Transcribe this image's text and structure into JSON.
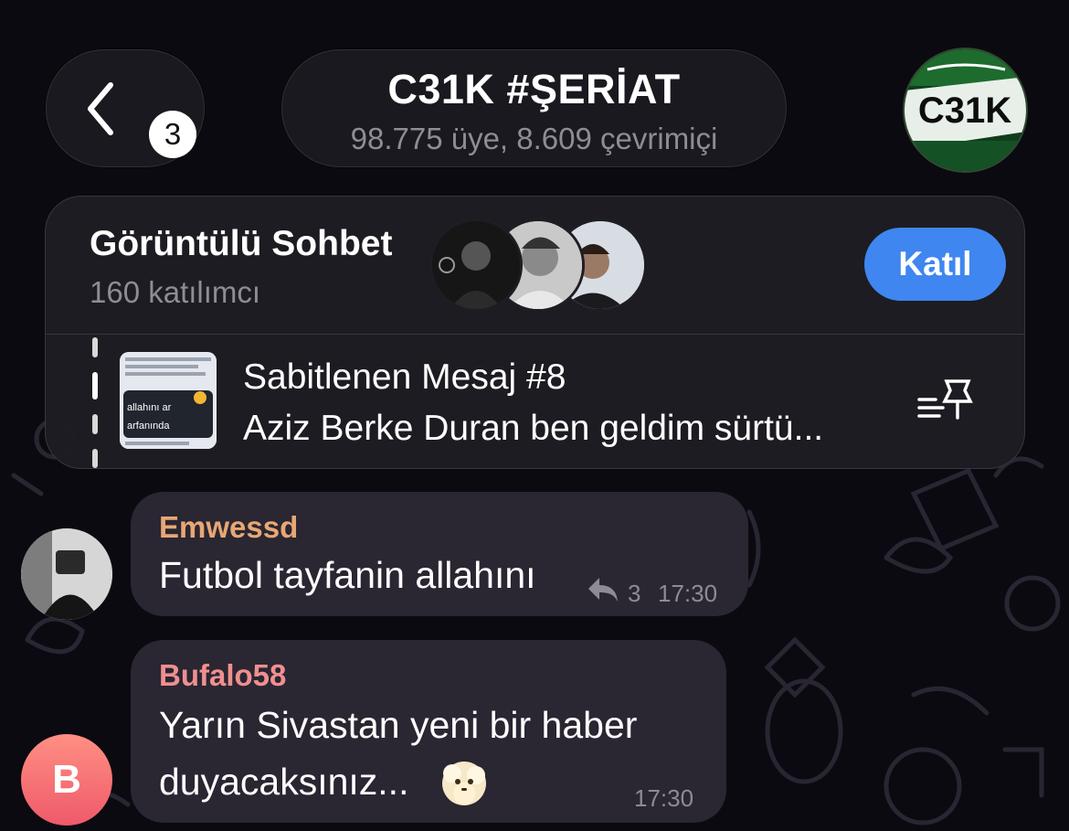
{
  "header": {
    "back_badge": "3",
    "title": "C31K #ŞERİAT",
    "subtitle": "98.775 üye, 8.609 çevrimiçi",
    "avatar_text": "C31K"
  },
  "video_chat": {
    "title": "Görüntülü Sohbet",
    "participants": "160 katılımcı",
    "join_label": "Katıl"
  },
  "pinned": {
    "title": "Sabitlenen Mesaj #8",
    "text": "Aziz Berke Duran ben geldim sürtü...",
    "thumb_line_1": "allahını ar",
    "thumb_line_2": "arfanında"
  },
  "messages": [
    {
      "sender": "Emwessd",
      "sender_color": "#e8a775",
      "text": "Futbol tayfanin allahını",
      "reply_count": "3",
      "time": "17:30"
    },
    {
      "sender": "Bufalo58",
      "sender_color": "#f08f8f",
      "avatar_letter": "B",
      "text_line_1": "Yarın Sivastan yeni bir haber",
      "text_line_2": "duyacaksınız...",
      "time": "17:30"
    }
  ],
  "colors": {
    "accent": "#3f86f0",
    "bubble": "#2a2632",
    "background": "#0b0a10"
  }
}
